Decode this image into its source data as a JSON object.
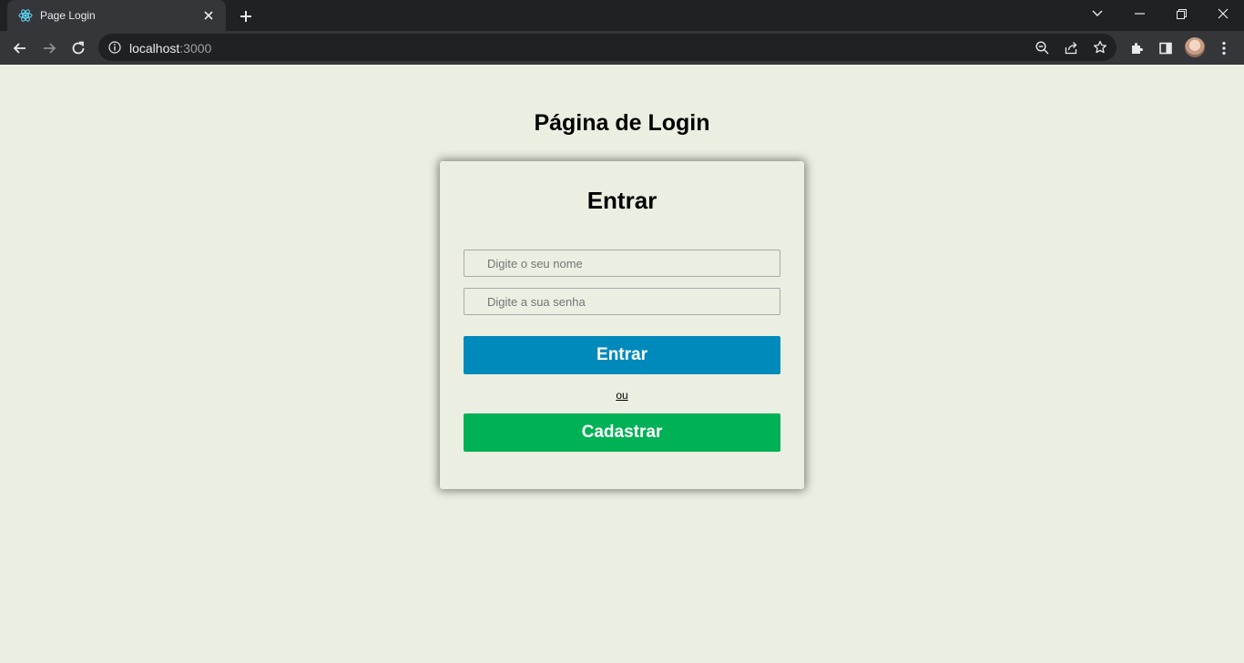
{
  "browser": {
    "tab": {
      "title": "Page Login"
    },
    "address": {
      "host": "localhost",
      "port": ":3000"
    }
  },
  "page": {
    "title": "Página de Login",
    "card": {
      "title": "Entrar",
      "username_placeholder": "Digite o seu nome",
      "password_placeholder": "Digite a sua senha",
      "login_label": "Entrar",
      "or_label": "ou",
      "register_label": "Cadastrar"
    }
  },
  "icons": {
    "favicon": "react-icon",
    "tab_close": "close-icon",
    "new_tab": "plus-icon",
    "back": "arrow-left-icon",
    "forward": "arrow-right-icon",
    "reload": "reload-icon",
    "site_info": "info-icon",
    "zoom": "zoom-out-icon",
    "share": "share-icon",
    "bookmark": "star-icon",
    "extensions": "puzzle-icon",
    "side_panel": "side-panel-icon",
    "menu": "kebab-menu-icon"
  },
  "colors": {
    "page_background": "#ebefe1",
    "login_button": "#008abc",
    "register_button": "#00b156",
    "chrome_dark": "#202124",
    "chrome_toolbar": "#35363a"
  }
}
